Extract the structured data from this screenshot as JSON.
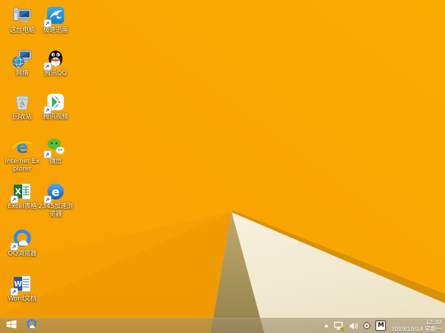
{
  "wallpaper": {
    "orange": "#F8A702",
    "orange_facet": "#F19B03",
    "orange_facet2": "#F4A004",
    "gold_edge": "#D9910A",
    "khaki_top": "#BFA96C",
    "khaki_bottom": "#92824B",
    "cream_top": "#F7F1DE",
    "cream_bottom": "#EDE4C8"
  },
  "desktop": {
    "icons": [
      {
        "type": "this-pc",
        "label": "这台电脑",
        "col": 1,
        "row": 1,
        "shortcut": false
      },
      {
        "type": "xunlei",
        "label": "极速迅雷",
        "col": 2,
        "row": 1,
        "shortcut": true
      },
      {
        "type": "network",
        "label": "网络",
        "col": 1,
        "row": 2,
        "shortcut": false
      },
      {
        "type": "tencent-qq",
        "label": "腾讯QQ",
        "col": 2,
        "row": 2,
        "shortcut": true
      },
      {
        "type": "recycle-bin",
        "label": "回收站",
        "col": 1,
        "row": 3,
        "shortcut": false
      },
      {
        "type": "tencent-video",
        "label": "腾讯视频",
        "col": 2,
        "row": 3,
        "shortcut": true
      },
      {
        "type": "internet-explorer",
        "label": "Internet Explorer",
        "col": 1,
        "row": 4,
        "shortcut": false
      },
      {
        "type": "wechat",
        "label": "微信",
        "col": 2,
        "row": 4,
        "shortcut": true
      },
      {
        "type": "excel",
        "label": "Excel表格",
        "col": 1,
        "row": 5,
        "shortcut": true
      },
      {
        "type": "browser-2345",
        "label": "2345加速浏览器",
        "col": 2,
        "row": 5,
        "shortcut": true
      },
      {
        "type": "qq-browser",
        "label": "QQ浏览器",
        "col": 1,
        "row": 6,
        "shortcut": true
      },
      {
        "type": "word",
        "label": "Word文档",
        "col": 1,
        "row": 7,
        "shortcut": true
      }
    ]
  },
  "taskbar": {
    "pinned": [
      {
        "type": "qq-browser"
      }
    ],
    "tray": [
      {
        "name": "hidden-icons"
      },
      {
        "name": "network-warning"
      },
      {
        "name": "volume"
      },
      {
        "name": "action-center"
      },
      {
        "name": "ime",
        "text": "M"
      }
    ],
    "clock": {
      "time": "12:30",
      "date": "2019/10/14 星期一"
    }
  }
}
